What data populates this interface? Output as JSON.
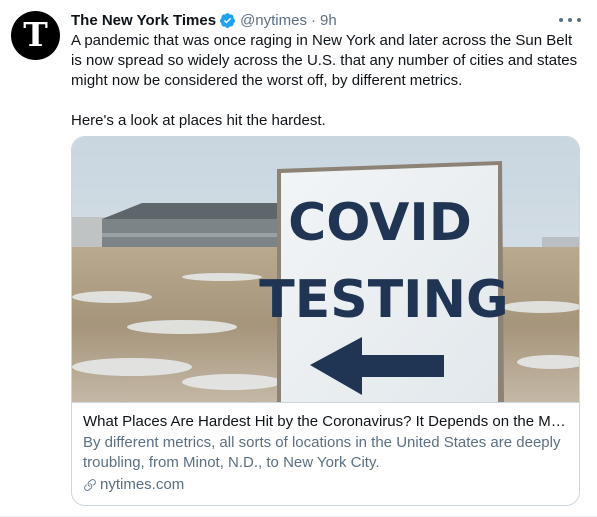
{
  "tweet": {
    "author_name": "The New York Times",
    "avatar_letter": "T",
    "handle": "@nytimes",
    "separator": "·",
    "time": "9h",
    "paragraphs": [
      "A pandemic that was once raging in New York and later across the Sun Belt is now spread so widely across the U.S. that any number of cities and states might now be considered the worst off, by different metrics.",
      "Here's a look at places hit the hardest."
    ]
  },
  "card": {
    "image_sign_line1": "COVID",
    "image_sign_line2": "TESTING",
    "title": "What Places Are Hardest Hit by the Coronavirus? It Depends on the Me…",
    "description": "By different metrics, all sorts of locations in the United States are deeply troubling, from Minot, N.D., to New York City.",
    "domain": "nytimes.com"
  },
  "icons": {
    "verified": "verified-badge-icon",
    "more": "more-options-icon",
    "link": "link-icon"
  },
  "colors": {
    "verified_blue": "#1da1f2",
    "secondary_text": "#5b7083",
    "sign_navy": "#1f3553"
  }
}
